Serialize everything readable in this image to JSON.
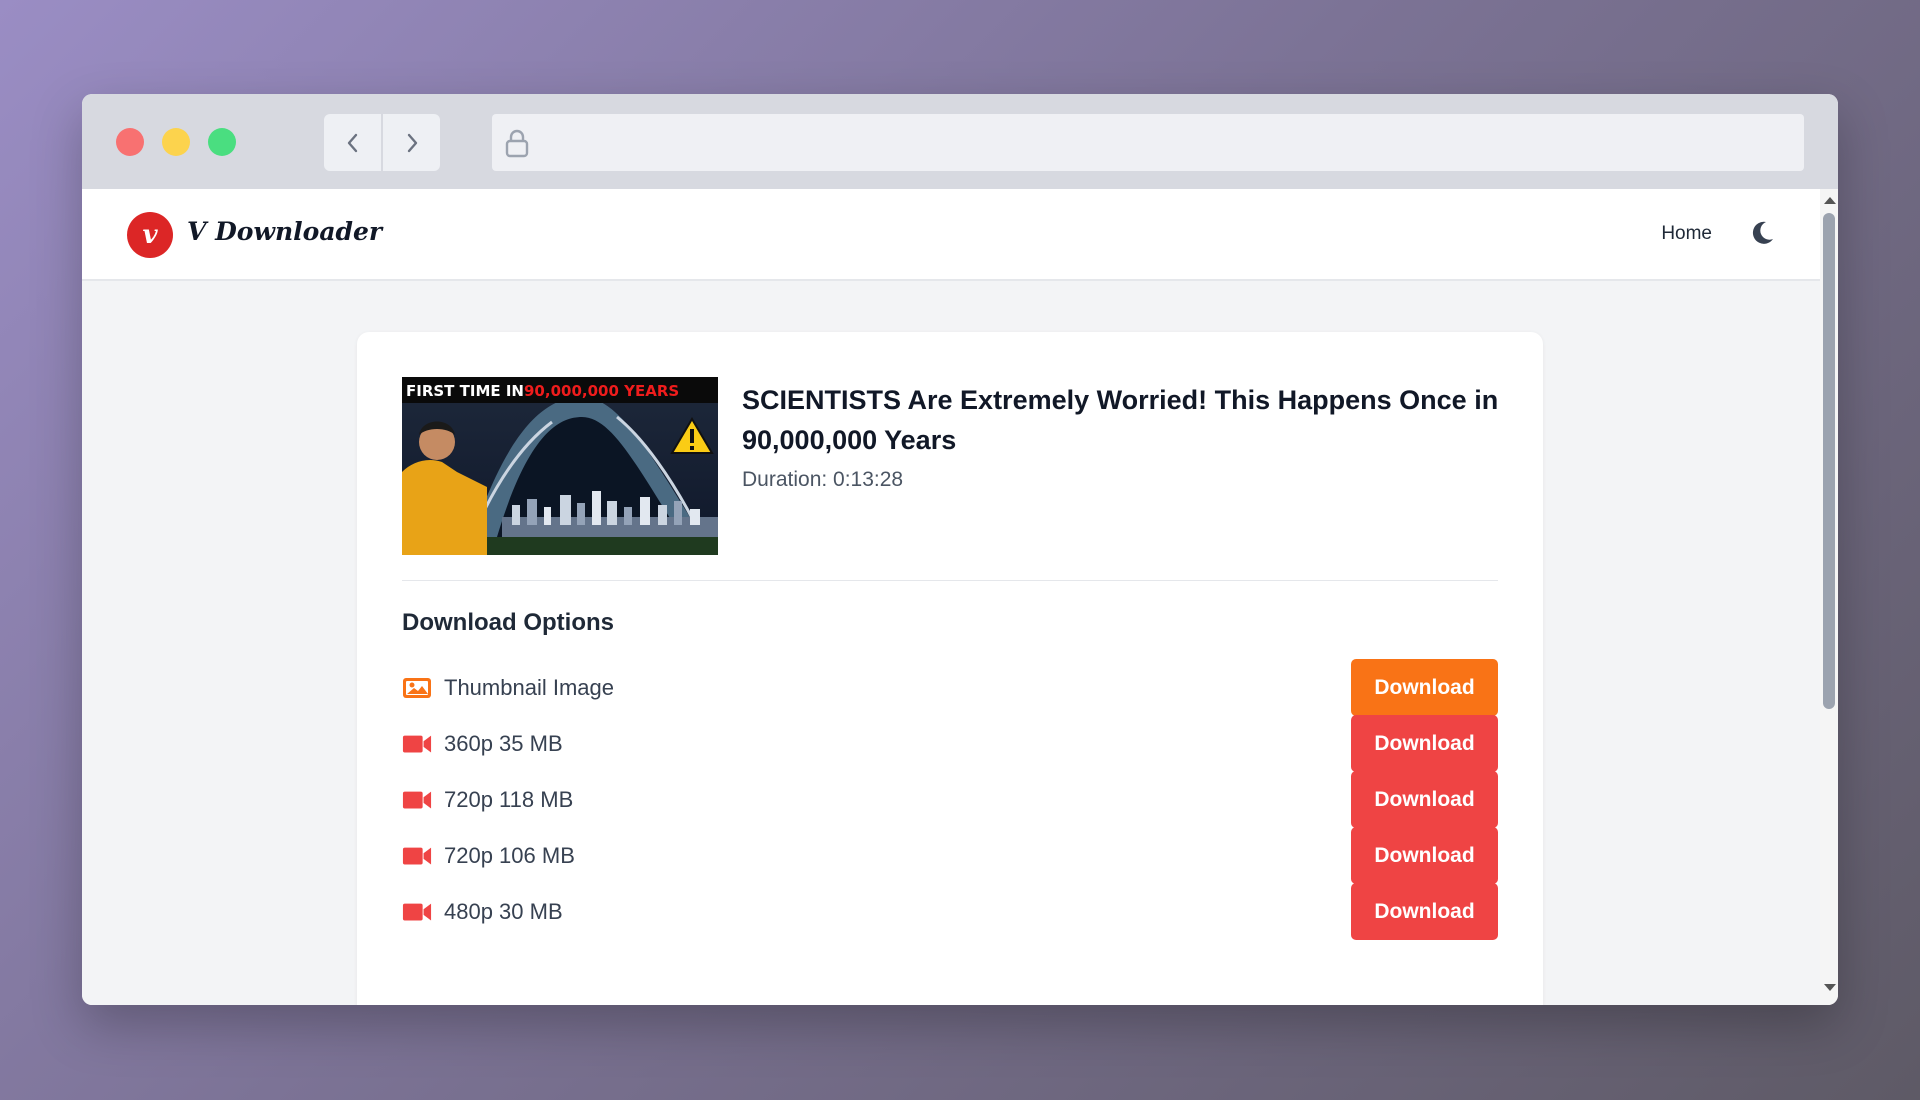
{
  "browser": {
    "back_icon": "chevron-left-icon",
    "forward_icon": "chevron-right-icon",
    "lock_icon": "lock-icon"
  },
  "header": {
    "brand_initial": "v",
    "brand_name": "V Downloader",
    "nav": {
      "home_label": "Home"
    },
    "theme_toggle_icon": "moon-icon"
  },
  "video": {
    "thumbnail_text_white": "FIRST TIME IN",
    "thumbnail_text_red": "90,000,000 YEARS",
    "title": "SCIENTISTS Are Extremely Worried! This Happens Once in 90,000,000 Years",
    "duration": "Duration: 0:13:28"
  },
  "download_options": {
    "title": "Download Options",
    "items": [
      {
        "icon": "image-icon",
        "label": "Thumbnail Image",
        "button_label": "Download",
        "button_color": "#f97316"
      },
      {
        "icon": "video-camera-icon",
        "label": "360p 35 MB",
        "button_label": "Download",
        "button_color": "#ef4444"
      },
      {
        "icon": "video-camera-icon",
        "label": "720p 118 MB",
        "button_label": "Download",
        "button_color": "#ef4444"
      },
      {
        "icon": "video-camera-icon",
        "label": "720p 106 MB",
        "button_label": "Download",
        "button_color": "#ef4444"
      },
      {
        "icon": "video-camera-icon",
        "label": "480p 30 MB",
        "button_label": "Download",
        "button_color": "#ef4444"
      }
    ]
  },
  "colors": {
    "brand_red": "#dc2626",
    "accent_orange": "#f97316",
    "button_red": "#ef4444"
  }
}
